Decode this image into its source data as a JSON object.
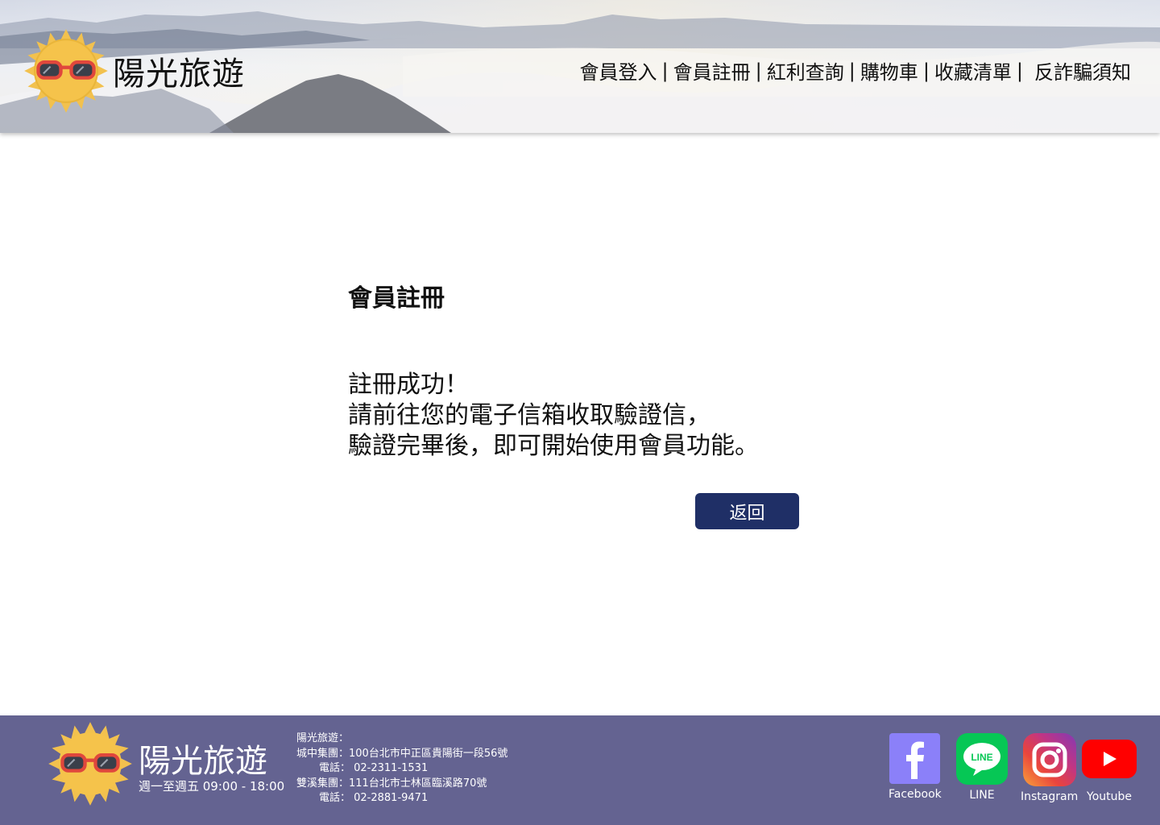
{
  "header": {
    "brand_name": "陽光旅遊",
    "nav": [
      {
        "label": "會員登入"
      },
      {
        "label": "會員註冊"
      },
      {
        "label": "紅利查詢"
      },
      {
        "label": "購物車"
      },
      {
        "label": "收藏清單"
      },
      {
        "label": "反詐騙須知"
      }
    ],
    "separator": "|"
  },
  "main": {
    "title": "會員註冊",
    "message_lines": [
      "註冊成功！",
      "請前往您的電子信箱收取驗證信，",
      "驗證完畢後，即可開始使用會員功能。"
    ],
    "back_label": "返回"
  },
  "footer": {
    "brand_name": "陽光旅遊",
    "hours": "週一至週五 09:00 - 18:00",
    "info_title": "陽光旅遊：",
    "branch1": "城中集團：100台北市中正區貴陽街一段56號",
    "branch1_phone": "電話： 02-2311-1531",
    "branch2": "雙溪集團：111台北市士林區臨溪路70號",
    "branch2_phone": "電話： 02-2881-9471",
    "social": [
      {
        "label": "Facebook",
        "icon": "facebook-icon",
        "color": "#8b80f9"
      },
      {
        "label": "LINE",
        "icon": "line-icon",
        "color": "#06c755"
      },
      {
        "label": "Instagram",
        "icon": "instagram-icon",
        "color": "#c13584"
      },
      {
        "label": "Youtube",
        "icon": "youtube-icon",
        "color": "#ff0000"
      }
    ]
  },
  "colors": {
    "accent": "#1f2f66",
    "footer_bg": "#646391",
    "sun": "#f2c14e",
    "glasses_frame": "#e0473c"
  }
}
